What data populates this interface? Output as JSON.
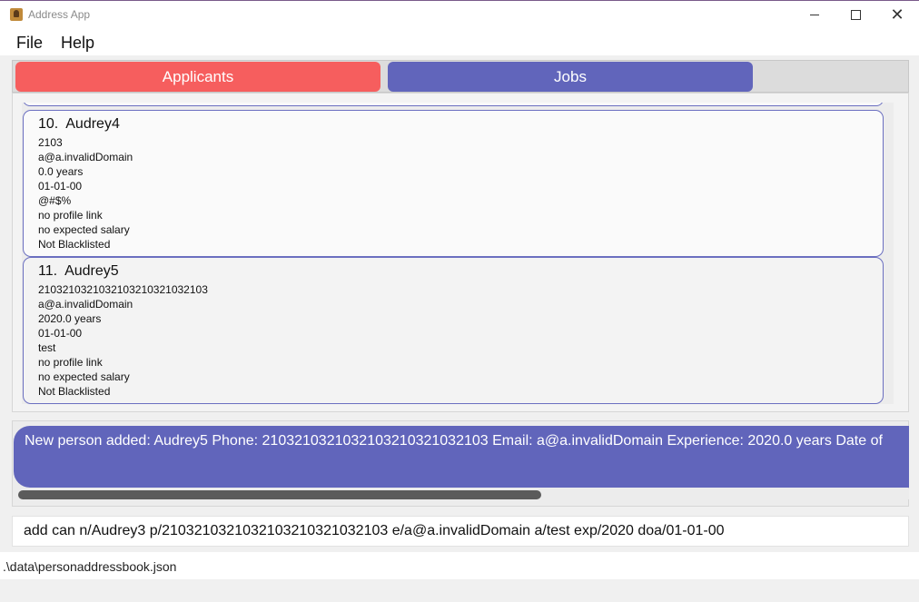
{
  "window": {
    "title": "Address App",
    "icon": "address-book-icon",
    "controls": {
      "minimize": "minimize-icon",
      "maximize": "maximize-icon",
      "close": "✕"
    }
  },
  "menu": {
    "file": "File",
    "help": "Help"
  },
  "tabs": [
    {
      "label": "Applicants",
      "color": "#f65e5e"
    },
    {
      "label": "Jobs",
      "color": "#6165bb"
    }
  ],
  "applicants": [
    {
      "index": "10.",
      "name": "Audrey4",
      "phone": "2103",
      "email": "a@a.invalidDomain",
      "experience": "0.0 years",
      "date": "01-01-00",
      "address": "@#$%",
      "profile": "no profile link",
      "salary": "no expected salary",
      "blacklist": "Not Blacklisted"
    },
    {
      "index": "11.",
      "name": "Audrey5",
      "phone": "2103210321032103210321032103",
      "email": "a@a.invalidDomain",
      "experience": "2020.0 years",
      "date": "01-01-00",
      "address": "test",
      "profile": "no profile link",
      "salary": "no expected salary",
      "blacklist": "Not Blacklisted"
    }
  ],
  "result": {
    "text": "New person added: Audrey5 Phone: 2103210321032103210321032103 Email: a@a.invalidDomain Experience: 2020.0 years Date of"
  },
  "command": {
    "value": "add can n/Audrey3 p/2103210321032103210321032103 e/a@a.invalidDomain a/test exp/2020 doa/01-01-00"
  },
  "status": {
    "path": ".\\data\\personaddressbook.json"
  },
  "colors": {
    "accent": "#6165bb",
    "applicants_tab": "#f65e5e"
  }
}
